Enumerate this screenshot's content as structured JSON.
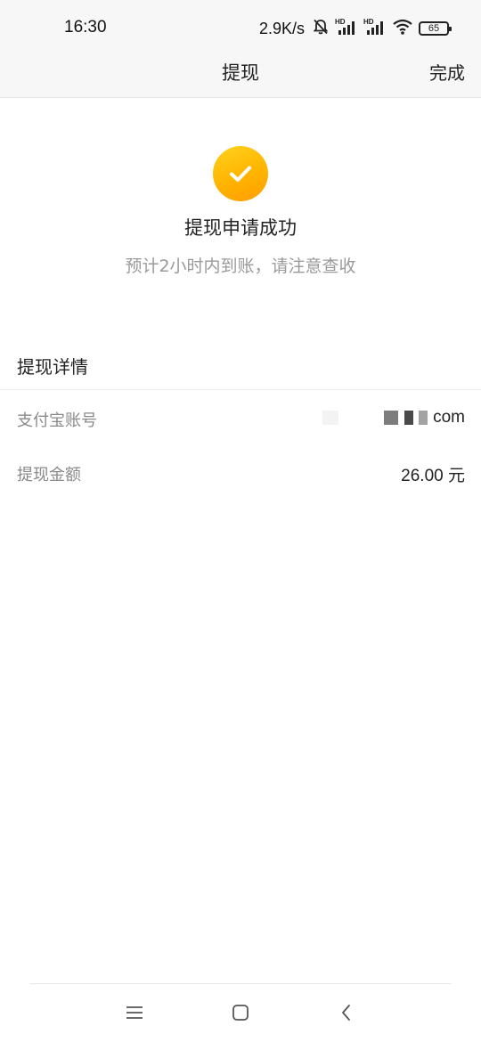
{
  "status_bar": {
    "time": "16:30",
    "net_speed": "2.9K/s",
    "battery": "65",
    "icons": [
      "bell-off-icon",
      "signal-hd-icon",
      "signal-hd-icon",
      "wifi-icon",
      "battery-icon"
    ]
  },
  "header": {
    "title": "提现",
    "done_label": "完成"
  },
  "result": {
    "icon": "check-circle-icon",
    "title": "提现申请成功",
    "subtitle": "预计2小时内到账，请注意查收",
    "accent_color": "#ffb400"
  },
  "details": {
    "section_title": "提现详情",
    "rows": [
      {
        "label": "支付宝账号",
        "value": "com"
      },
      {
        "label": "提现金额",
        "value": "26.00 元"
      }
    ]
  },
  "system_nav": {
    "icons": [
      "menu-icon",
      "home-icon",
      "back-icon"
    ]
  }
}
